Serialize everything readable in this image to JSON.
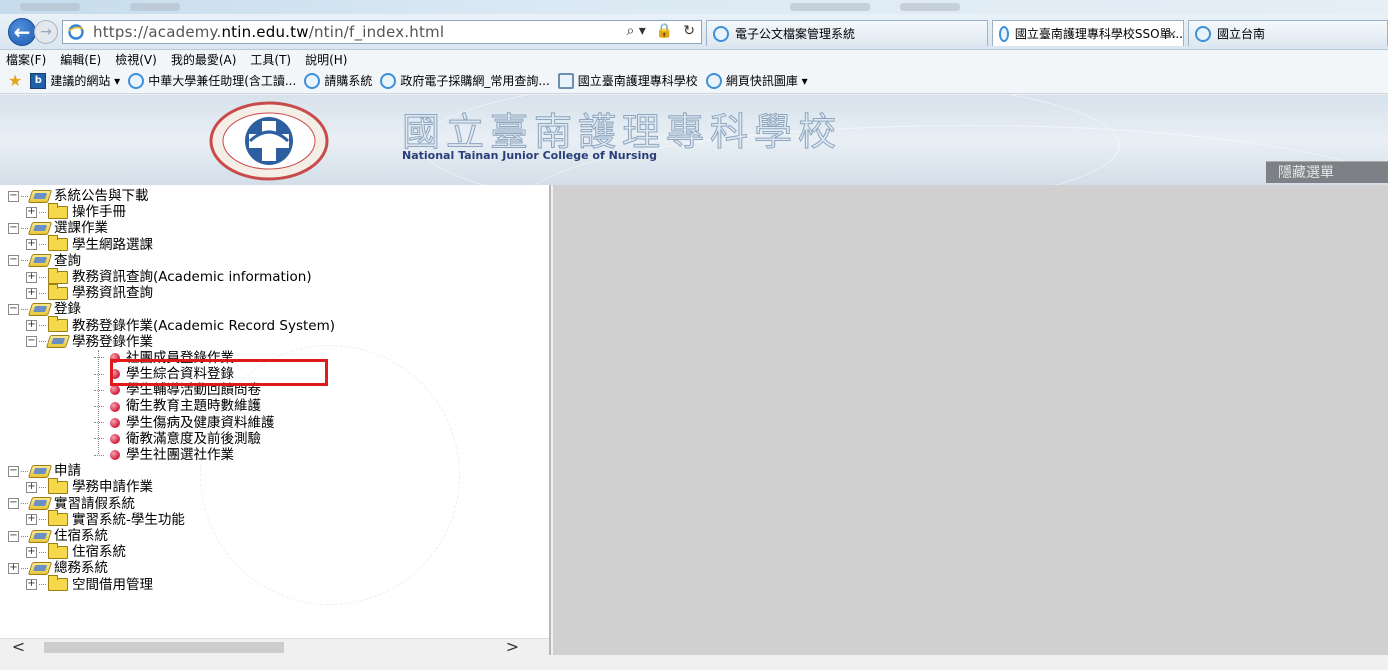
{
  "browser": {
    "url_prefix": "https://academy.",
    "url_host": "ntin.edu.tw",
    "url_path": "/ntin/f_index.html",
    "address_tools": [
      "⌕ ▾",
      "🔒",
      "↻"
    ],
    "tabs": [
      {
        "label": "電子公文檔案管理系統",
        "active": false
      },
      {
        "label": "國立臺南護理專科學校SSO單...",
        "active": true
      },
      {
        "label": "國立台南",
        "active": false
      }
    ],
    "tab_close": "×"
  },
  "menubar": [
    "檔案(F)",
    "編輯(E)",
    "檢視(V)",
    "我的最愛(A)",
    "工具(T)",
    "說明(H)"
  ],
  "favorites": [
    {
      "label": "建議的網站 ▾",
      "icon": "bing-icon"
    },
    {
      "label": "中華大學兼任助理(含工讀...",
      "icon": "ie-icon"
    },
    {
      "label": "請購系統",
      "icon": "ie-icon"
    },
    {
      "label": "政府電子採購網_常用查詢...",
      "icon": "ie-icon"
    },
    {
      "label": "國立臺南護理專科學校",
      "icon": "page-icon"
    },
    {
      "label": "網頁快訊圖庫 ▾",
      "icon": "ie-icon"
    }
  ],
  "banner": {
    "title": "國立臺南護理專科學校",
    "subtitle": "National Tainan Junior College of Nursing",
    "hide_menu": "隱藏選單"
  },
  "tree": {
    "groups": [
      {
        "label": "系統公告與下載",
        "children": [
          {
            "label": "操作手冊"
          }
        ]
      },
      {
        "label": "選課作業",
        "children": [
          {
            "label": "學生網路選課"
          }
        ]
      },
      {
        "label": "查詢",
        "children": [
          {
            "label": "教務資訊查詢(Academic information)"
          },
          {
            "label": "學務資訊查詢"
          }
        ]
      },
      {
        "label": "登錄",
        "children": [
          {
            "label": "教務登錄作業(Academic Record System)"
          },
          {
            "label": "學務登錄作業",
            "leaves": [
              "社團成員登錄作業",
              "學生綜合資料登錄",
              "學生輔導活動回饋問卷",
              "衛生教育主題時數維護",
              "學生傷病及健康資料維護",
              "衛教滿意度及前後測驗",
              "學生社團選社作業"
            ]
          }
        ]
      },
      {
        "label": "申請",
        "children": [
          {
            "label": "學務申請作業"
          }
        ]
      },
      {
        "label": "實習請假系統",
        "children": [
          {
            "label": "實習系統-學生功能"
          }
        ]
      },
      {
        "label": "住宿系統",
        "children": [
          {
            "label": "住宿系統"
          }
        ]
      },
      {
        "label": "總務系統",
        "children": [
          {
            "label": "空間借用管理"
          }
        ]
      }
    ],
    "highlighted": "學生綜合資料登錄"
  },
  "scrollbar": {
    "left": "<",
    "right": ">"
  },
  "colors": {
    "highlight": "#e01a1a",
    "content_bg": "#d0d0d0",
    "banner_text": "#2a3f7a"
  }
}
